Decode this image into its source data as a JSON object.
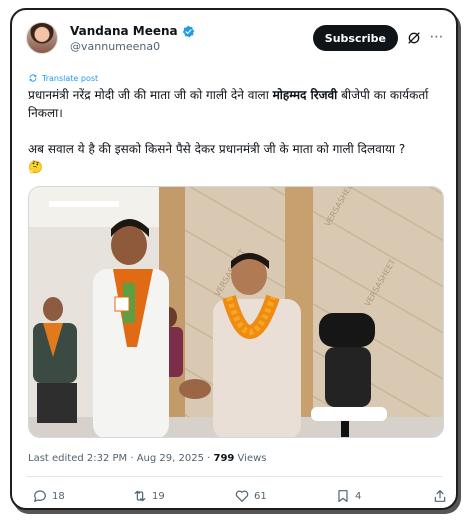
{
  "author": {
    "display_name": "Vandana Meena",
    "handle": "@vannumeena0",
    "verified_color": "#1d9bf0"
  },
  "header": {
    "subscribe_label": "Subscribe"
  },
  "translate": {
    "label": "Translate post"
  },
  "tweet": {
    "line1_pre": "प्रधानमंत्री नरेंद्र मोदी जी की माता जी को गाली देने वाला ",
    "line1_bold": "मोहम्मद रिजवी",
    "line1_post": " बीजेपी का कार्यकर्ता निकला।",
    "line2": "अब सवाल ये है की इसको किसने पैसे देकर प्रधानमंत्री जी के माता को गाली दिलवाया ?",
    "emoji": "🤔"
  },
  "meta": {
    "edited": "Last edited 2:32 PM · Aug 29, 2025 · ",
    "views_count": "799",
    "views_label": " Views"
  },
  "actions": {
    "replies": "18",
    "reposts": "19",
    "likes": "61",
    "bookmarks": "4"
  },
  "media": {
    "wall_text": "VERSASHEET"
  }
}
